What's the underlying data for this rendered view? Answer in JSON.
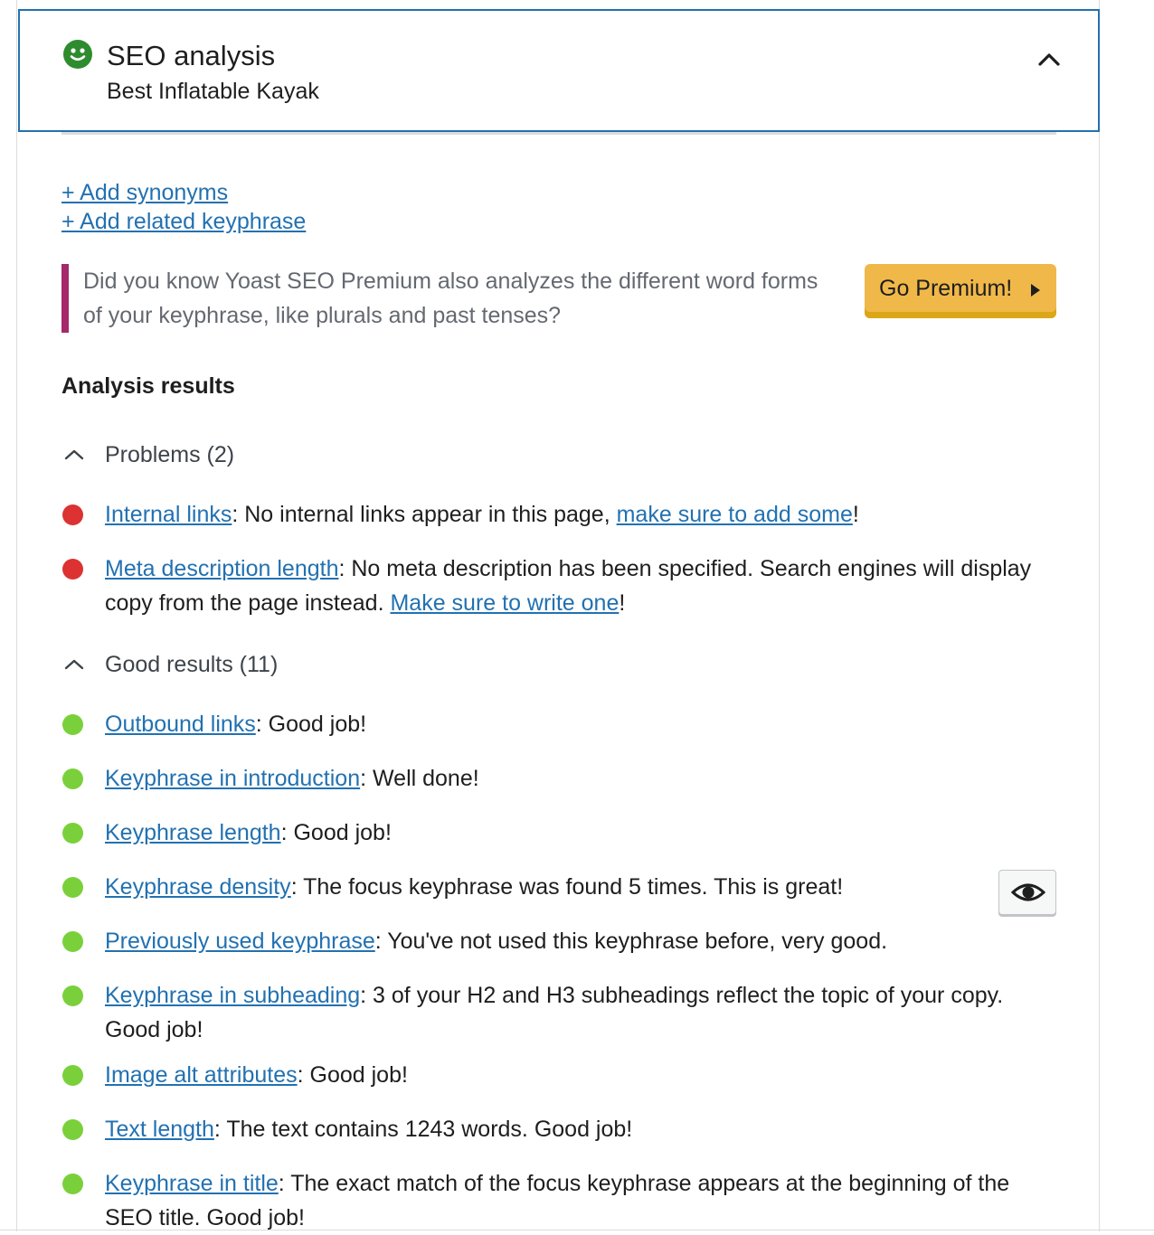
{
  "header": {
    "title": "SEO analysis",
    "subtitle": "Best Inflatable Kayak",
    "status_color": "#2e8b2e"
  },
  "links": {
    "add_synonyms": "+ Add synonyms",
    "add_related_keyphrase": "+ Add related keyphrase"
  },
  "promo": {
    "text": "Did you know Yoast SEO Premium also analyzes the different word forms of your keyphrase, like plurals and past tenses?",
    "button_label": "Go Premium!",
    "accent_color": "#a4286a",
    "button_color": "#f0b849"
  },
  "results": {
    "heading": "Analysis results",
    "problems": {
      "label": "Problems (2)",
      "items": [
        {
          "link": "Internal links",
          "text": ": No internal links appear in this page, ",
          "action": "make sure to add some",
          "end": "!"
        },
        {
          "link": "Meta description length",
          "text": ": No meta description has been specified. Search engines will display copy from the page instead. ",
          "action": "Make sure to write one",
          "end": "!"
        }
      ]
    },
    "good": {
      "label": "Good results (11)",
      "items": [
        {
          "link": "Outbound links",
          "text": ": Good job!"
        },
        {
          "link": "Keyphrase in introduction",
          "text": ": Well done!"
        },
        {
          "link": "Keyphrase length",
          "text": ": Good job!"
        },
        {
          "link": "Keyphrase density",
          "text": ": The focus keyphrase was found 5 times. This is great!"
        },
        {
          "link": "Previously used keyphrase",
          "text": ": You've not used this keyphrase before, very good."
        },
        {
          "link": "Keyphrase in subheading",
          "text": ": 3 of your H2 and H3 subheadings reflect the topic of your copy. Good job!"
        },
        {
          "link": "Image alt attributes",
          "text": ": Good job!"
        },
        {
          "link": "Text length",
          "text": ": The text contains 1243 words. Good job!"
        },
        {
          "link": "Keyphrase in title",
          "text": ": The exact match of the focus keyphrase appears at the beginning of the SEO title. Good job!"
        }
      ]
    }
  },
  "colors": {
    "link": "#2271b1",
    "problem_dot": "#dc3232",
    "good_dot": "#7ad03a",
    "focus_border": "#2271b1"
  }
}
